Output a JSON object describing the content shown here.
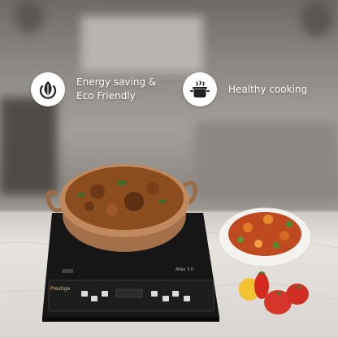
{
  "features": [
    {
      "icon": "leaf-power-icon",
      "lines": [
        "Energy saving &",
        "Eco Friendly"
      ]
    },
    {
      "icon": "cooking-pot-icon",
      "lines": [
        "Healthy cooking"
      ]
    }
  ],
  "product": {
    "brand": "Prestige",
    "model": "Atlas 3.0"
  },
  "colors": {
    "badge_bg": "#ffffff",
    "cooktop": "#151515",
    "pan_copper": "#b9835a",
    "curry": "#8a4a1c"
  }
}
